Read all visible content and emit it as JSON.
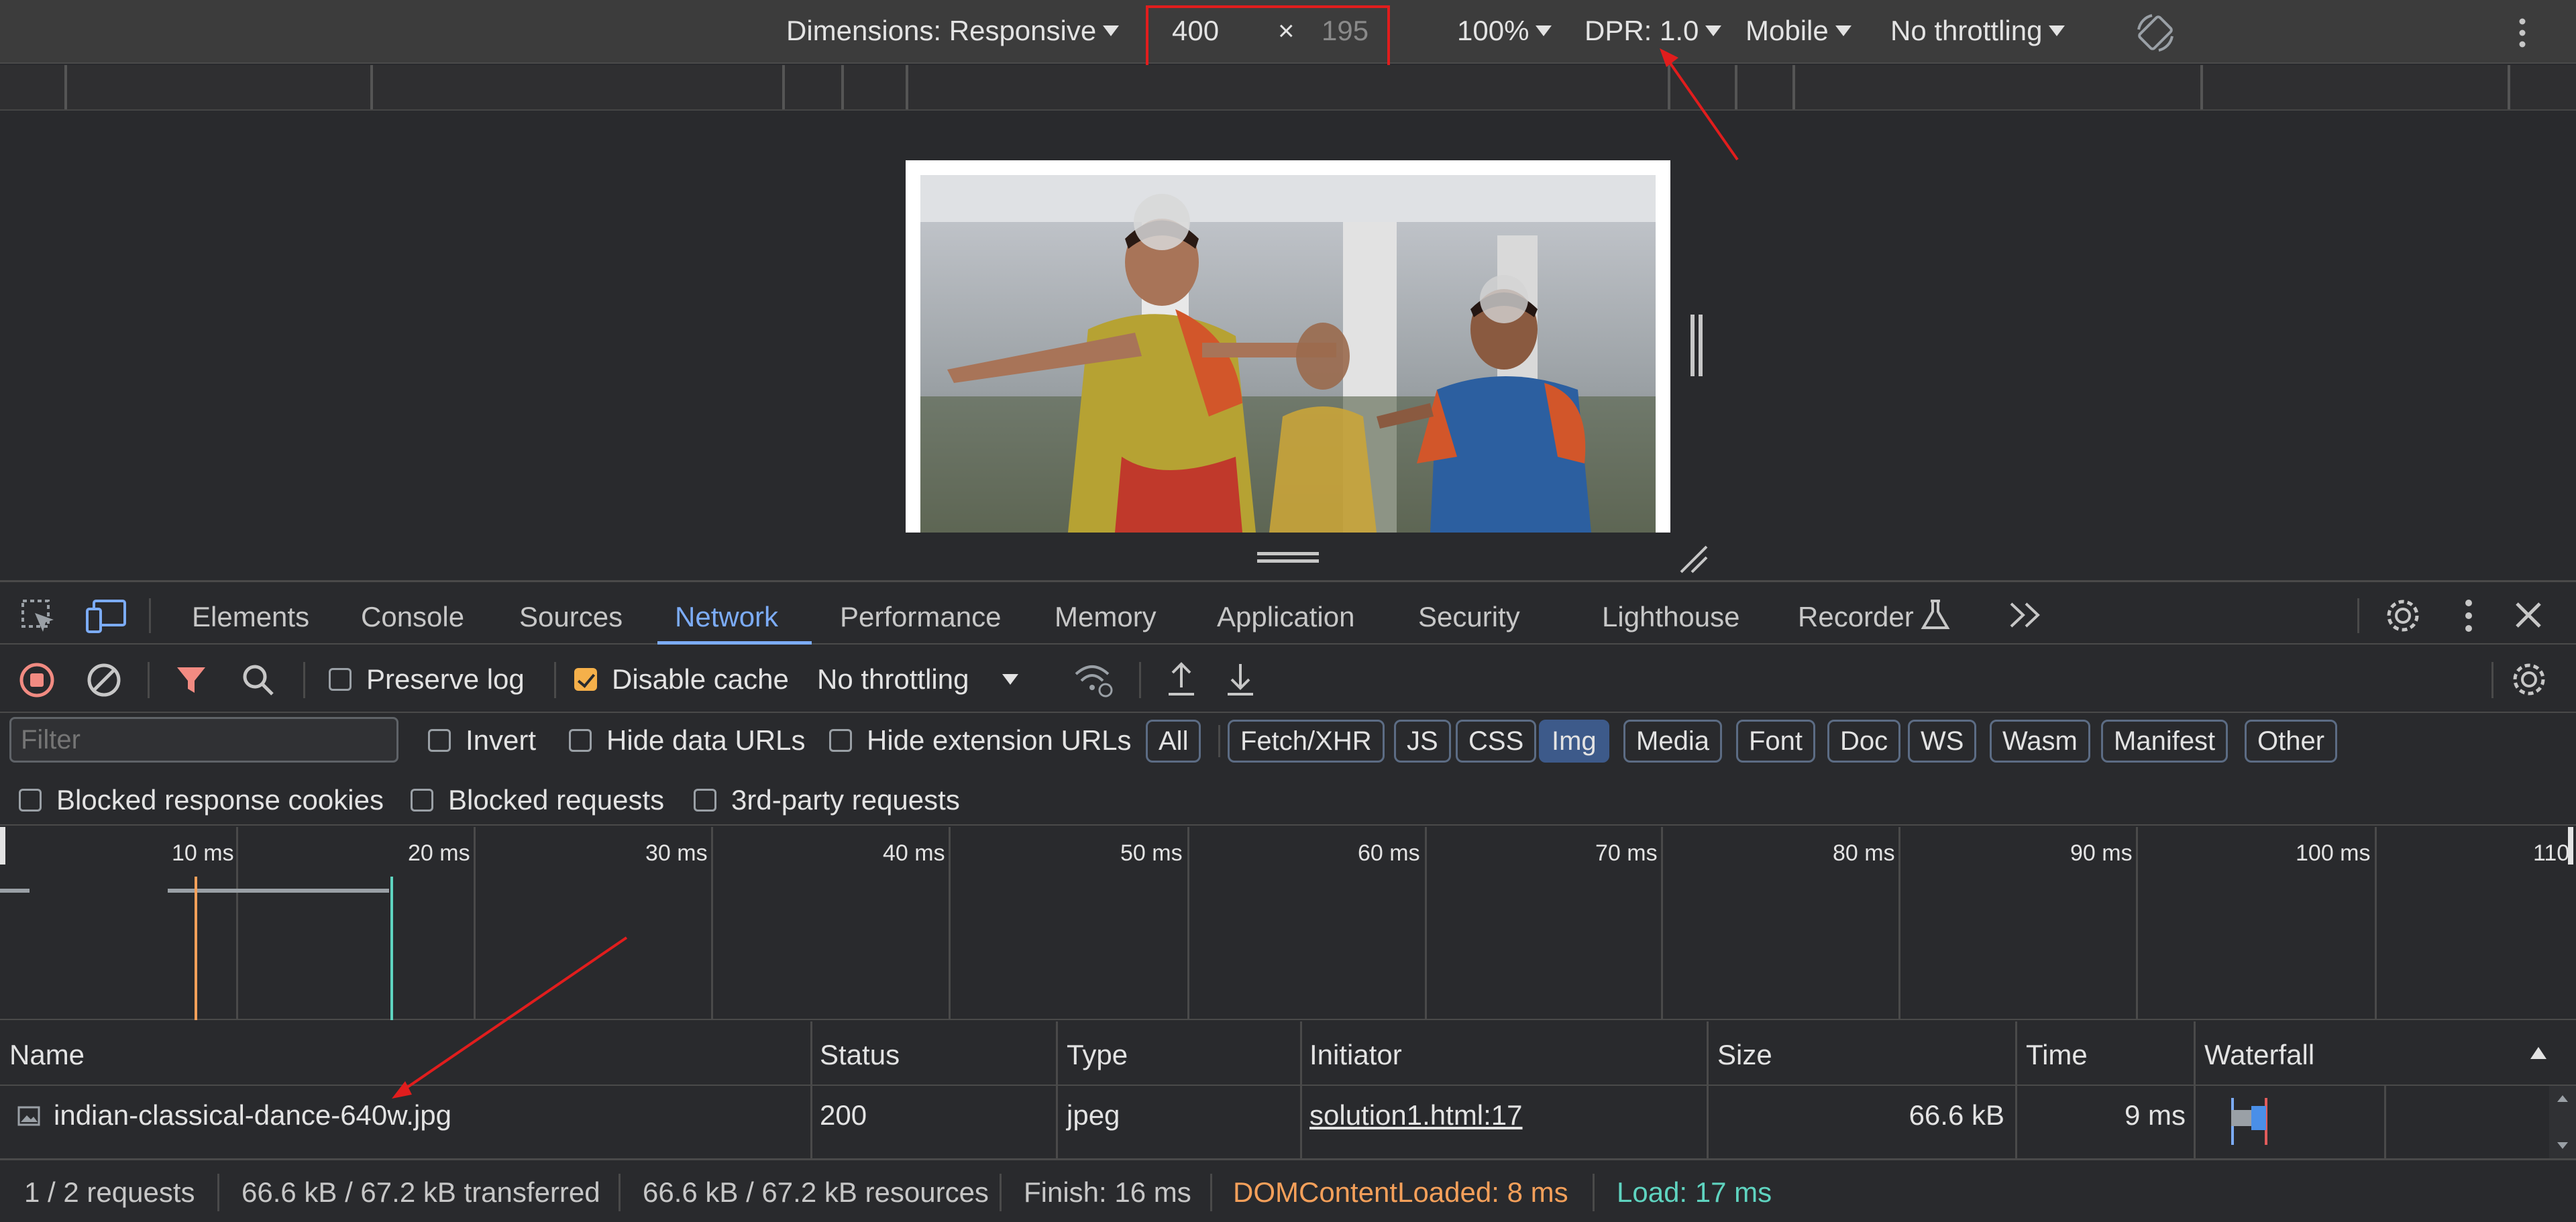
{
  "device_toolbar": {
    "dimensions_label": "Dimensions: Responsive",
    "width_value": "400",
    "times": "×",
    "height_placeholder": "195",
    "zoom": "100%",
    "dpr": "DPR: 1.0",
    "device_type": "Mobile",
    "throttling": "No throttling"
  },
  "tabs": [
    "Elements",
    "Console",
    "Sources",
    "Network",
    "Performance",
    "Memory",
    "Application",
    "Security",
    "Lighthouse",
    "Recorder"
  ],
  "active_tab": "Network",
  "network_toolbar": {
    "preserve_log": "Preserve log",
    "disable_cache": "Disable cache",
    "throttling": "No throttling"
  },
  "filter": {
    "placeholder": "Filter",
    "invert": "Invert",
    "hide_data_urls": "Hide data URLs",
    "hide_extension_urls": "Hide extension URLs",
    "chips": [
      "All",
      "Fetch/XHR",
      "JS",
      "CSS",
      "Img",
      "Media",
      "Font",
      "Doc",
      "WS",
      "Wasm",
      "Manifest",
      "Other"
    ],
    "active_chip": "Img",
    "blocked_response_cookies": "Blocked response cookies",
    "blocked_requests": "Blocked requests",
    "third_party_requests": "3rd-party requests"
  },
  "overview": {
    "ticks": [
      "10 ms",
      "20 ms",
      "30 ms",
      "40 ms",
      "50 ms",
      "60 ms",
      "70 ms",
      "80 ms",
      "90 ms",
      "100 ms",
      "110"
    ],
    "domcontentloaded_color": "#f5a05a",
    "load_color": "#5fd4c0"
  },
  "table": {
    "headers": [
      "Name",
      "Status",
      "Type",
      "Initiator",
      "Size",
      "Time",
      "Waterfall"
    ],
    "rows": [
      {
        "name": "indian-classical-dance-640w.jpg",
        "status": "200",
        "type": "jpeg",
        "initiator": "solution1.html:17",
        "size": "66.6 kB",
        "time": "9 ms"
      }
    ]
  },
  "status_bar": {
    "requests": "1 / 2 requests",
    "transferred": "66.6 kB / 67.2 kB transferred",
    "resources": "66.6 kB / 67.2 kB resources",
    "finish": "Finish: 16 ms",
    "dom_content_loaded": "DOMContentLoaded: 8 ms",
    "load": "Load: 17 ms"
  },
  "colors": {
    "accent": "#7cacf8",
    "annotation": "#e11d1d",
    "record": "#f28b82",
    "dcl": "#f5a05a",
    "load": "#5fd4c0"
  }
}
